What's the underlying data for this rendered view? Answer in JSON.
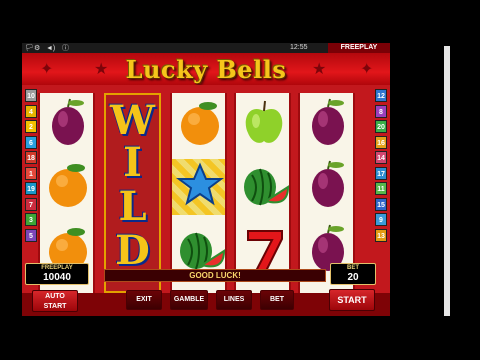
{
  "status": {
    "time": "12:55",
    "mode": "FREEPLAY"
  },
  "game": {
    "title": "Lucky Bells",
    "message": "GOOD LUCK!"
  },
  "paylines": {
    "left": [
      {
        "n": "10",
        "color": "#9c9c9c"
      },
      {
        "n": "4",
        "color": "#e6b400"
      },
      {
        "n": "2",
        "color": "#f2c000"
      },
      {
        "n": "6",
        "color": "#29a0df"
      },
      {
        "n": "18",
        "color": "#d23a2a"
      },
      {
        "n": "1",
        "color": "#e4483a"
      },
      {
        "n": "19",
        "color": "#1a96c8"
      },
      {
        "n": "7",
        "color": "#cc2b3e"
      },
      {
        "n": "3",
        "color": "#3ea536"
      },
      {
        "n": "5",
        "color": "#7c45b8"
      }
    ],
    "right": [
      {
        "n": "12",
        "color": "#2f75d0"
      },
      {
        "n": "8",
        "color": "#9a3fbd"
      },
      {
        "n": "20",
        "color": "#3aae48"
      },
      {
        "n": "16",
        "color": "#e5a01a"
      },
      {
        "n": "14",
        "color": "#d1466f"
      },
      {
        "n": "17",
        "color": "#2d8cd0"
      },
      {
        "n": "11",
        "color": "#56b74b"
      },
      {
        "n": "15",
        "color": "#3066c9"
      },
      {
        "n": "9",
        "color": "#3b9ad8"
      },
      {
        "n": "13",
        "color": "#e39a12"
      }
    ]
  },
  "reels": [
    [
      "plum-icon",
      "orange-icon",
      "orange-icon"
    ],
    [
      "wild",
      "wild",
      "wild"
    ],
    [
      "orange-icon",
      "star-icon",
      "watermelon-icon"
    ],
    [
      "apple-icon",
      "watermelon-icon",
      "seven-icon"
    ],
    [
      "plum-icon",
      "plum-icon",
      "plum-icon"
    ]
  ],
  "wild_text": [
    "W",
    "I",
    "L",
    "D"
  ],
  "credit": {
    "label": "FREEPLAY",
    "value": "10040"
  },
  "bet": {
    "label": "BET",
    "value": "20"
  },
  "buttons": {
    "autostart": "AUTO START",
    "exit": "EXIT",
    "gamble": "GAMBLE",
    "lines": "LINES",
    "bet": "BET",
    "start": "START"
  },
  "colors": {
    "felt": "#8e0508",
    "gold": "#f6c51b",
    "wild_blue": "#0a2a8a"
  }
}
